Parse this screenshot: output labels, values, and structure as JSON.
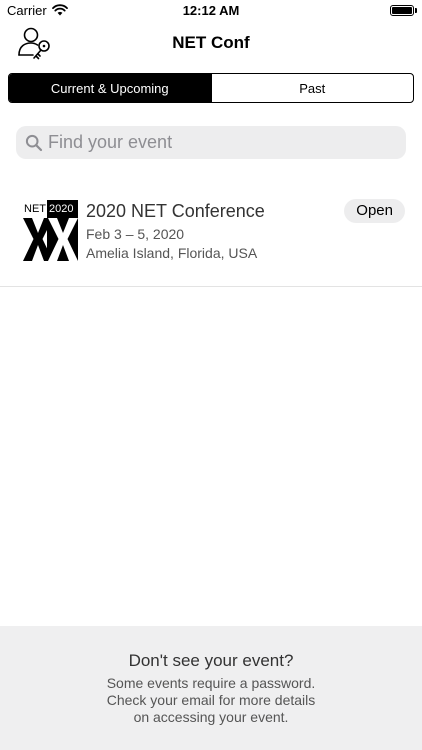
{
  "status_bar": {
    "carrier": "Carrier",
    "time": "12:12 AM",
    "icons": [
      "wifi-icon",
      "battery-icon"
    ]
  },
  "nav": {
    "title": "NET Conf",
    "left_icon": "profile-key-icon"
  },
  "segments": {
    "items": [
      {
        "label": "Current & Upcoming",
        "selected": true
      },
      {
        "label": "Past",
        "selected": false
      }
    ]
  },
  "search": {
    "placeholder": "Find your event",
    "value": "",
    "icon": "search-icon"
  },
  "events": [
    {
      "title": "2020 NET Conference",
      "dates": "Feb 3 – 5, 2020",
      "location": "Amelia Island, Florida, USA",
      "status": "Open",
      "logo": {
        "top_left": "NET",
        "top_right": "2020",
        "main": "XX"
      }
    }
  ],
  "footer": {
    "title": "Don't see your event?",
    "body_lines": [
      "Some events require a password.",
      "Check your email for more details",
      "on accessing your event."
    ]
  },
  "colors": {
    "segment_selected_bg": "#000000",
    "search_bg": "#ededee",
    "footer_bg": "#efeff0",
    "status_pill_bg": "#ededee"
  }
}
